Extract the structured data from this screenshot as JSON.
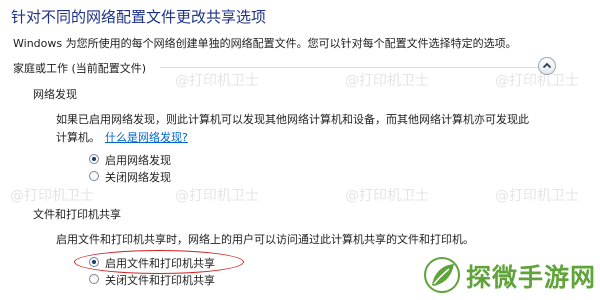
{
  "title": "针对不同的网络配置文件更改共享选项",
  "description": "Windows 为您所使用的每个网络创建单独的网络配置文件。您可以针对每个配置文件选择特定的选项。",
  "profile": {
    "label": "家庭或工作 (当前配置文件)",
    "collapse_icon": "chevron-up-icon"
  },
  "network_discovery": {
    "title": "网络发现",
    "text_line1": "如果已启用网络发现，则此计算机可以发现其他网络计算机和设备，而其他网络计算机亦可发现此",
    "text_line2": "计算机。",
    "help_link": "什么是网络发现?",
    "options": [
      {
        "label": "启用网络发现",
        "selected": true
      },
      {
        "label": "关闭网络发现",
        "selected": false
      }
    ]
  },
  "file_sharing": {
    "title": "文件和打印机共享",
    "text": "启用文件和打印机共享时，网络上的用户可以访问通过此计算机共享的文件和打印机。",
    "options": [
      {
        "label": "启用文件和打印机共享",
        "selected": true
      },
      {
        "label": "关闭文件和打印机共享",
        "selected": false
      }
    ]
  },
  "watermark": {
    "text": "@打印机卫士",
    "brand": "探微手游网"
  },
  "colors": {
    "title": "#1e3287",
    "link": "#0066cc",
    "highlight": "#d02020",
    "brand": "#5fa33a"
  }
}
